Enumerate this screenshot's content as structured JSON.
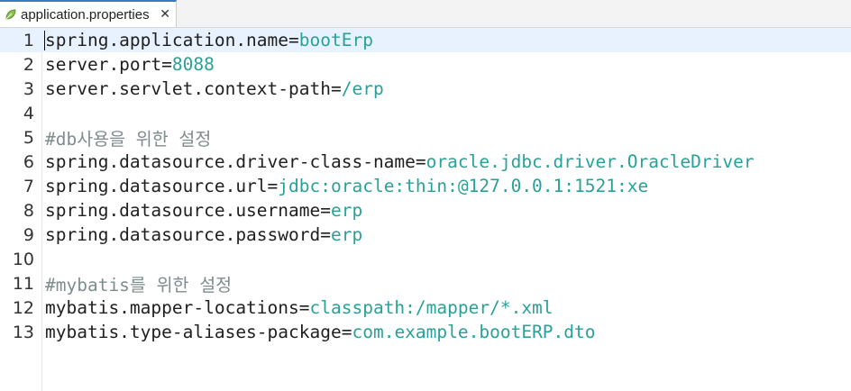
{
  "tab": {
    "title": "application.properties",
    "close": "✕",
    "icon": "spring-leaf-icon",
    "accent": "#3c78c8"
  },
  "colors": {
    "key": "#1f1f1f",
    "value": "#2aa198",
    "comment": "#7f8c8d",
    "current_line": "#e8f2fe"
  },
  "lines": [
    {
      "num": "1",
      "key": "spring.application.name",
      "eq": "=",
      "value": "bootErp"
    },
    {
      "num": "2",
      "key": "server.port",
      "eq": "=",
      "value": "8088"
    },
    {
      "num": "3",
      "key": "server.servlet.context-path",
      "eq": "=",
      "value": "/erp"
    },
    {
      "num": "4"
    },
    {
      "num": "5",
      "comment": "#db사용을 위한 설정"
    },
    {
      "num": "6",
      "key": "spring.datasource.driver-class-name",
      "eq": "=",
      "value": "oracle.jdbc.driver.OracleDriver"
    },
    {
      "num": "7",
      "key": "spring.datasource.url",
      "eq": "=",
      "value": "jdbc:oracle:thin:@127.0.0.1:1521:xe"
    },
    {
      "num": "8",
      "key": "spring.datasource.username",
      "eq": "=",
      "value": "erp"
    },
    {
      "num": "9",
      "key": "spring.datasource.password",
      "eq": "=",
      "value": "erp"
    },
    {
      "num": "10"
    },
    {
      "num": "11",
      "comment": "#mybatis를 위한 설정"
    },
    {
      "num": "12",
      "key": "mybatis.mapper-locations",
      "eq": "=",
      "value": "classpath:/mapper/*.xml"
    },
    {
      "num": "13",
      "key": "mybatis.type-aliases-package",
      "eq": "=",
      "value": "com.example.bootERP.dto"
    }
  ]
}
